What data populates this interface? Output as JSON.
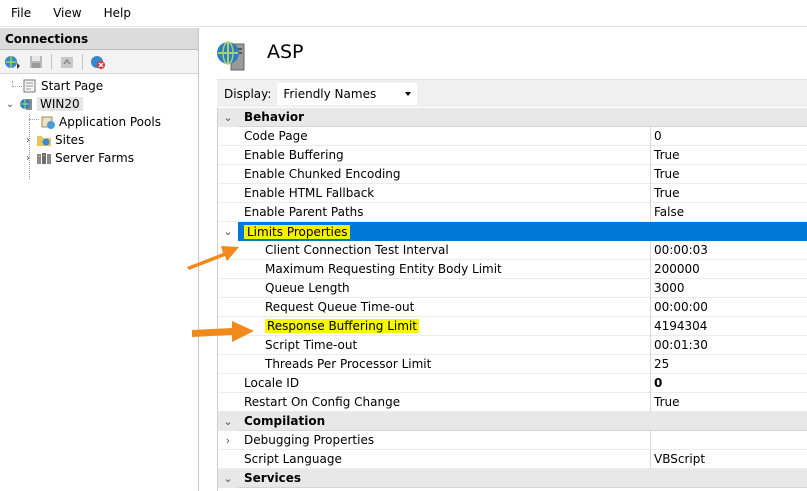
{
  "menu": [
    "File",
    "View",
    "Help"
  ],
  "connections": {
    "title": "Connections",
    "tree": {
      "start_page": "Start Page",
      "server": "WIN20",
      "application_pools": "Application Pools",
      "sites": "Sites",
      "server_farms": "Server Farms"
    }
  },
  "page": {
    "title": "ASP",
    "display_label": "Display:",
    "display_value": "Friendly Names"
  },
  "grid": {
    "behavior": "Behavior",
    "code_page": {
      "name": "Code Page",
      "value": "0"
    },
    "enable_buffering": {
      "name": "Enable Buffering",
      "value": "True"
    },
    "enable_chunked": {
      "name": "Enable Chunked Encoding",
      "value": "True"
    },
    "enable_html_fallback": {
      "name": "Enable HTML Fallback",
      "value": "True"
    },
    "enable_parent_paths": {
      "name": "Enable Parent Paths",
      "value": "False"
    },
    "limits_properties": "Limits Properties",
    "client_conn_test": {
      "name": "Client Connection Test Interval",
      "value": "00:00:03"
    },
    "max_request_body": {
      "name": "Maximum Requesting Entity Body Limit",
      "value": "200000"
    },
    "queue_length": {
      "name": "Queue Length",
      "value": "3000"
    },
    "request_queue_timeout": {
      "name": "Request Queue Time-out",
      "value": "00:00:00"
    },
    "response_buffering": {
      "name": "Response Buffering Limit",
      "value": "4194304"
    },
    "script_timeout": {
      "name": "Script Time-out",
      "value": "00:01:30"
    },
    "threads_per_processor": {
      "name": "Threads Per Processor Limit",
      "value": "25"
    },
    "locale_id": {
      "name": "Locale ID",
      "value": "0"
    },
    "restart_on_config": {
      "name": "Restart On Config Change",
      "value": "True"
    },
    "compilation": "Compilation",
    "debugging_properties": {
      "name": "Debugging Properties",
      "value": ""
    },
    "script_language": {
      "name": "Script Language",
      "value": "VBScript"
    },
    "services": "Services"
  },
  "colors": {
    "selection": "#0078d7",
    "highlight": "#f7f700",
    "arrow": "#f28a1b"
  }
}
